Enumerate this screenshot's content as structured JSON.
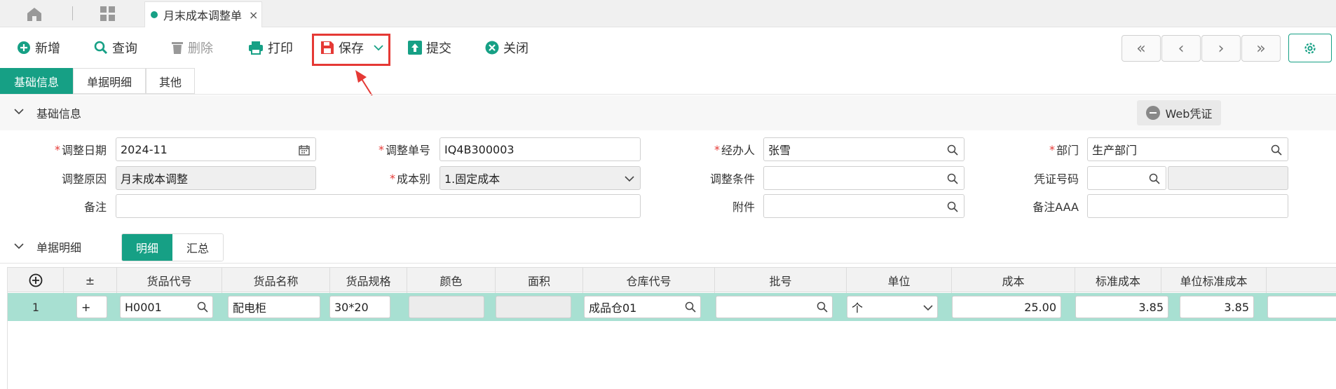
{
  "tab": {
    "title": "月末成本调整单",
    "close": "×"
  },
  "toolbar": {
    "add": "新增",
    "query": "查询",
    "delete": "删除",
    "print": "打印",
    "save": "保存",
    "submit": "提交",
    "close": "关闭"
  },
  "nav": {
    "first": "«",
    "prev": "‹",
    "next": "›",
    "last": "»"
  },
  "subtabs": [
    "基础信息",
    "单据明细",
    "其他"
  ],
  "basic_section": {
    "title": "基础信息",
    "web_voucher": "Web凭证"
  },
  "form": {
    "adjust_date": {
      "label": "调整日期",
      "value": "2024-11"
    },
    "adjust_no": {
      "label": "调整单号",
      "value": "IQ4B300003"
    },
    "handler": {
      "label": "经办人",
      "value": "张雪"
    },
    "department": {
      "label": "部门",
      "value": "生产部门"
    },
    "reason": {
      "label": "调整原因",
      "value": "月末成本调整"
    },
    "cost_type": {
      "label": "成本别",
      "value": "1.固定成本"
    },
    "condition": {
      "label": "调整条件",
      "value": ""
    },
    "voucher_no": {
      "label": "凭证号码",
      "value": ""
    },
    "remark": {
      "label": "备注",
      "value": ""
    },
    "attachment": {
      "label": "附件",
      "value": ""
    },
    "remark_aaa": {
      "label": "备注AAA",
      "value": ""
    }
  },
  "detail_section": {
    "title": "单据明细",
    "tabs": [
      "明细",
      "汇总"
    ]
  },
  "table": {
    "headers": [
      "±",
      "货品代号",
      "货品名称",
      "货品规格",
      "颜色",
      "面积",
      "仓库代号",
      "批号",
      "单位",
      "成本",
      "标准成本",
      "单位标准成本"
    ],
    "row": {
      "index": "1",
      "pm": "+",
      "code": "H0001",
      "name": "配电柜",
      "spec": "30*20",
      "color": "",
      "area": "",
      "warehouse": "成品仓01",
      "batch": "",
      "unit": "个",
      "cost": "25.00",
      "std_cost": "3.85",
      "unit_std_cost": "3.85"
    }
  },
  "colors": {
    "accent": "#16a085",
    "highlight": "#e53935",
    "row": "#a8e0d2"
  }
}
